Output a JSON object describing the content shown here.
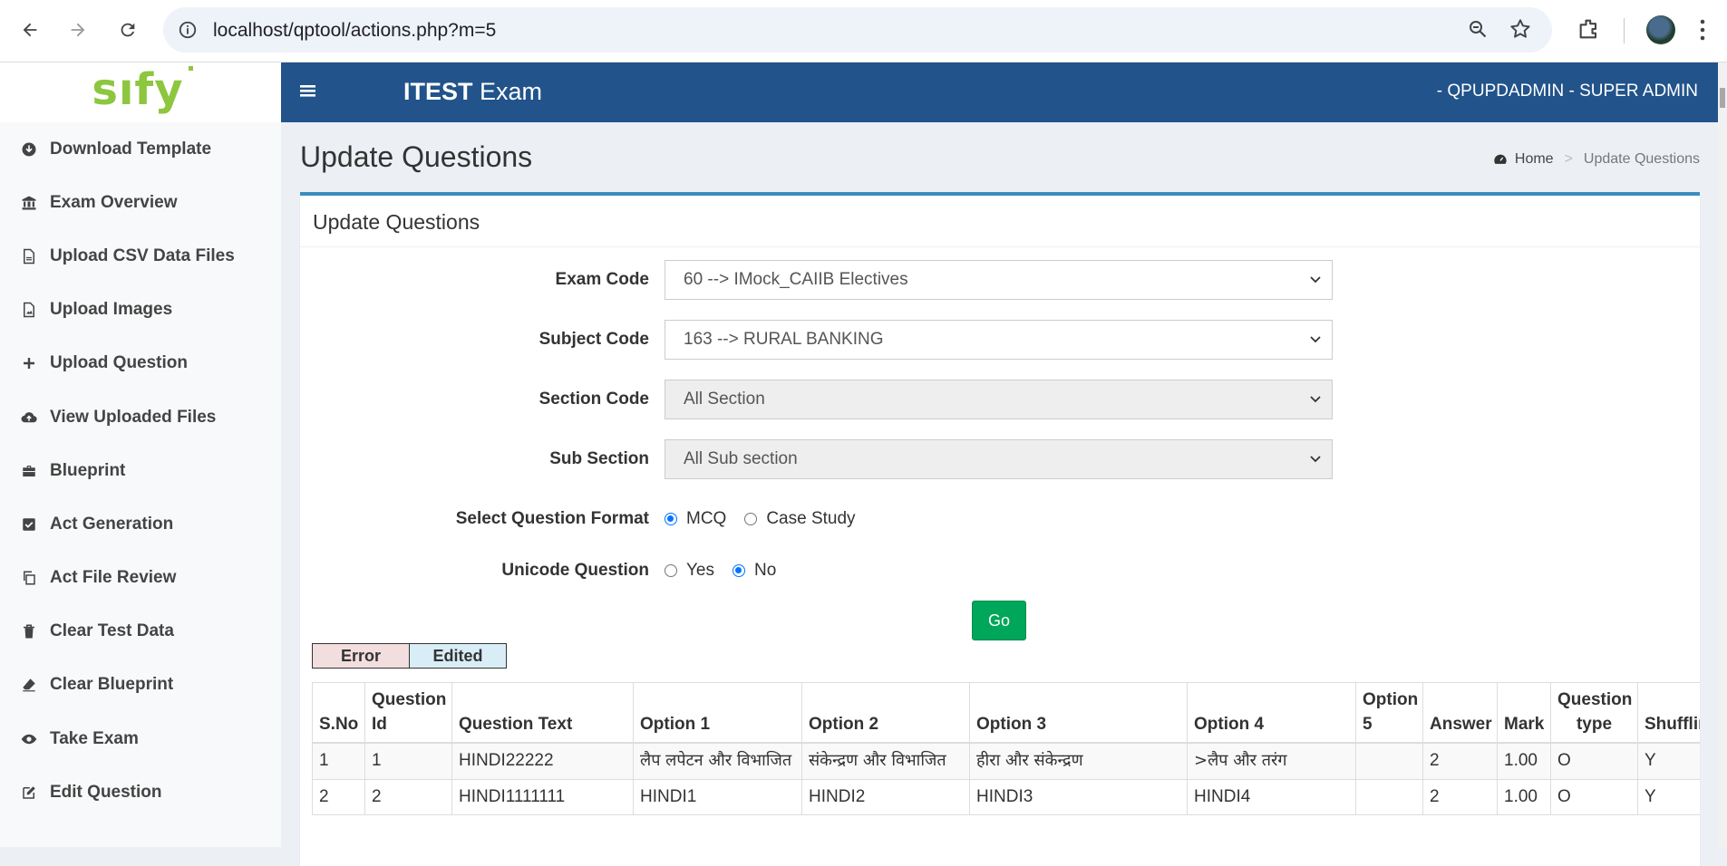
{
  "browser": {
    "url": "localhost/qptool/actions.php?m=5"
  },
  "logo": {
    "text": "sıfy"
  },
  "sidebar": {
    "items": [
      {
        "label": "Download Template",
        "icon": "download-circle-icon"
      },
      {
        "label": "Exam Overview",
        "icon": "bank-icon"
      },
      {
        "label": "Upload CSV Data Files",
        "icon": "file-icon"
      },
      {
        "label": "Upload Images",
        "icon": "image-file-icon"
      },
      {
        "label": "Upload Question",
        "icon": "plus-icon"
      },
      {
        "label": "View Uploaded Files",
        "icon": "cloud-upload-icon"
      },
      {
        "label": "Blueprint",
        "icon": "briefcase-icon"
      },
      {
        "label": "Act Generation",
        "icon": "check-square-icon"
      },
      {
        "label": "Act File Review",
        "icon": "copy-icon"
      },
      {
        "label": "Clear Test Data",
        "icon": "trash-icon"
      },
      {
        "label": "Clear Blueprint",
        "icon": "eraser-icon"
      },
      {
        "label": "Take Exam",
        "icon": "eye-icon"
      },
      {
        "label": "Edit Question",
        "icon": "edit-icon"
      }
    ]
  },
  "header": {
    "brand_bold": "ITEST",
    "brand_rest": " Exam",
    "user": "- QPUPDADMIN - SUPER ADMIN"
  },
  "page": {
    "title": "Update Questions",
    "breadcrumb_home": "Home",
    "breadcrumb_sep": ">",
    "breadcrumb_current": "Update Questions"
  },
  "form": {
    "box_title": "Update Questions",
    "exam_code_label": "Exam Code",
    "exam_code_value": "60 --> IMock_CAIIB Electives",
    "subject_code_label": "Subject Code",
    "subject_code_value": "163 --> RURAL BANKING",
    "section_code_label": "Section Code",
    "section_code_value": "All Section",
    "sub_section_label": "Sub Section",
    "sub_section_value": "All Sub section",
    "format_label": "Select Question Format",
    "format_mcq": "MCQ",
    "format_case": "Case Study",
    "format_selected": "MCQ",
    "unicode_label": "Unicode Question",
    "unicode_yes": "Yes",
    "unicode_no": "No",
    "unicode_selected": "No",
    "go_label": "Go"
  },
  "legend": {
    "error": "Error",
    "edited": "Edited"
  },
  "table": {
    "headers": {
      "sno": "S.No",
      "qid": "Question Id",
      "qtext": "Question Text",
      "opt1": "Option 1",
      "opt2": "Option 2",
      "opt3": "Option 3",
      "opt4": "Option 4",
      "opt5": "Option 5",
      "answer": "Answer",
      "mark": "Mark",
      "qtype": "Question type",
      "shuffling": "Shuffling"
    },
    "rows": [
      {
        "sno": "1",
        "qid": "1",
        "qtext": "HINDI22222",
        "opt1": "लैप लपेटन और विभाजित",
        "opt2": "संकेन्द्रण और विभाजित",
        "opt3": "हीरा और संकेन्द्रण",
        "opt4": ">लैप और तरंग",
        "opt5": "",
        "answer": "2",
        "mark": "1.00",
        "qtype": "O",
        "shuffling": "Y"
      },
      {
        "sno": "2",
        "qid": "2",
        "qtext": "HINDI1111111",
        "opt1": "HINDI1",
        "opt2": "HINDI2",
        "opt3": "HINDI3",
        "opt4": "HINDI4",
        "opt5": "",
        "answer": "2",
        "mark": "1.00",
        "qtype": "O",
        "shuffling": "Y"
      }
    ]
  }
}
